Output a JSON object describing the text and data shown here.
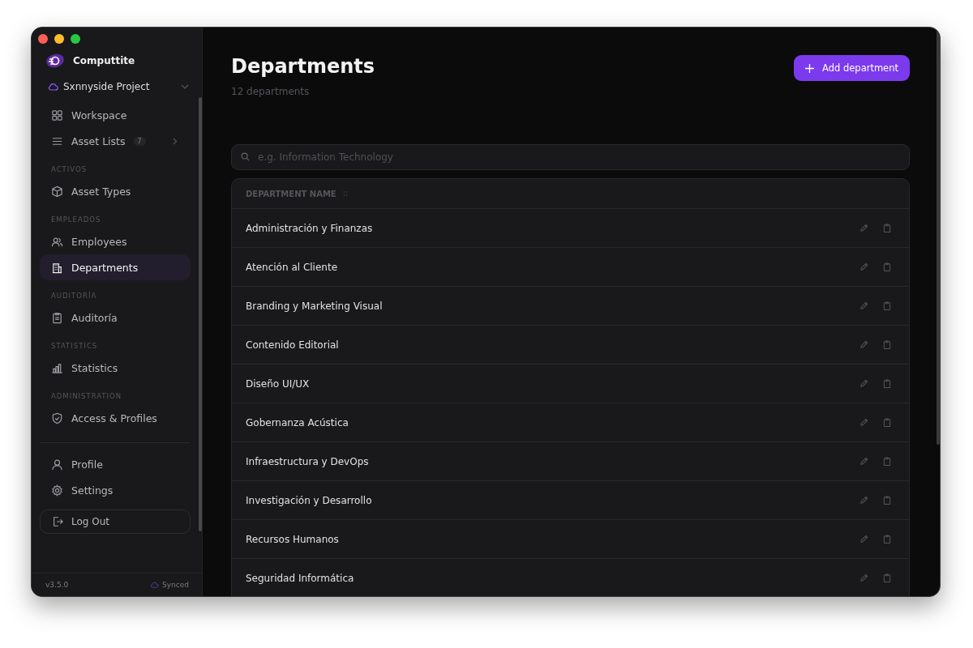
{
  "app": {
    "name": "Computtite"
  },
  "project": {
    "name": "Sxnnyside Project"
  },
  "sidebar": {
    "sections": [
      {
        "items": [
          {
            "label": "Workspace",
            "selected": false
          },
          {
            "label": "Asset Lists",
            "badge": "7",
            "selected": false
          }
        ]
      },
      {
        "heading": "ACTIVOS",
        "items": [
          {
            "label": "Asset Types",
            "selected": false
          }
        ]
      },
      {
        "heading": "EMPLEADOS",
        "items": [
          {
            "label": "Employees",
            "selected": false
          },
          {
            "label": "Departments",
            "selected": true
          }
        ]
      },
      {
        "heading": "AUDITORÍA",
        "items": [
          {
            "label": "Auditoría",
            "selected": false
          }
        ]
      },
      {
        "heading": "STATISTICS",
        "items": [
          {
            "label": "Statistics",
            "selected": false
          }
        ]
      },
      {
        "heading": "ADMINISTRATION",
        "items": [
          {
            "label": "Access & Profiles",
            "selected": false
          }
        ]
      }
    ],
    "bottom_items": [
      {
        "label": "Profile"
      },
      {
        "label": "Settings"
      }
    ],
    "logout": "Log Out",
    "version": "v3.5.0",
    "sync_status": "Synced"
  },
  "page": {
    "title": "Departments",
    "subtitle": "12 departments",
    "add_button": "Add department"
  },
  "search": {
    "placeholder": "e.g. Information Technology"
  },
  "table": {
    "columns": [
      "DEPARTMENT NAME"
    ],
    "rows": [
      "Administración y Finanzas",
      "Atención al Cliente",
      "Branding y Marketing Visual",
      "Contenido Editorial",
      "Diseño UI/UX",
      "Gobernanza Acústica",
      "Infraestructura y DevOps",
      "Investigación y Desarrollo",
      "Recursos Humanos",
      "Seguridad Informática"
    ]
  }
}
